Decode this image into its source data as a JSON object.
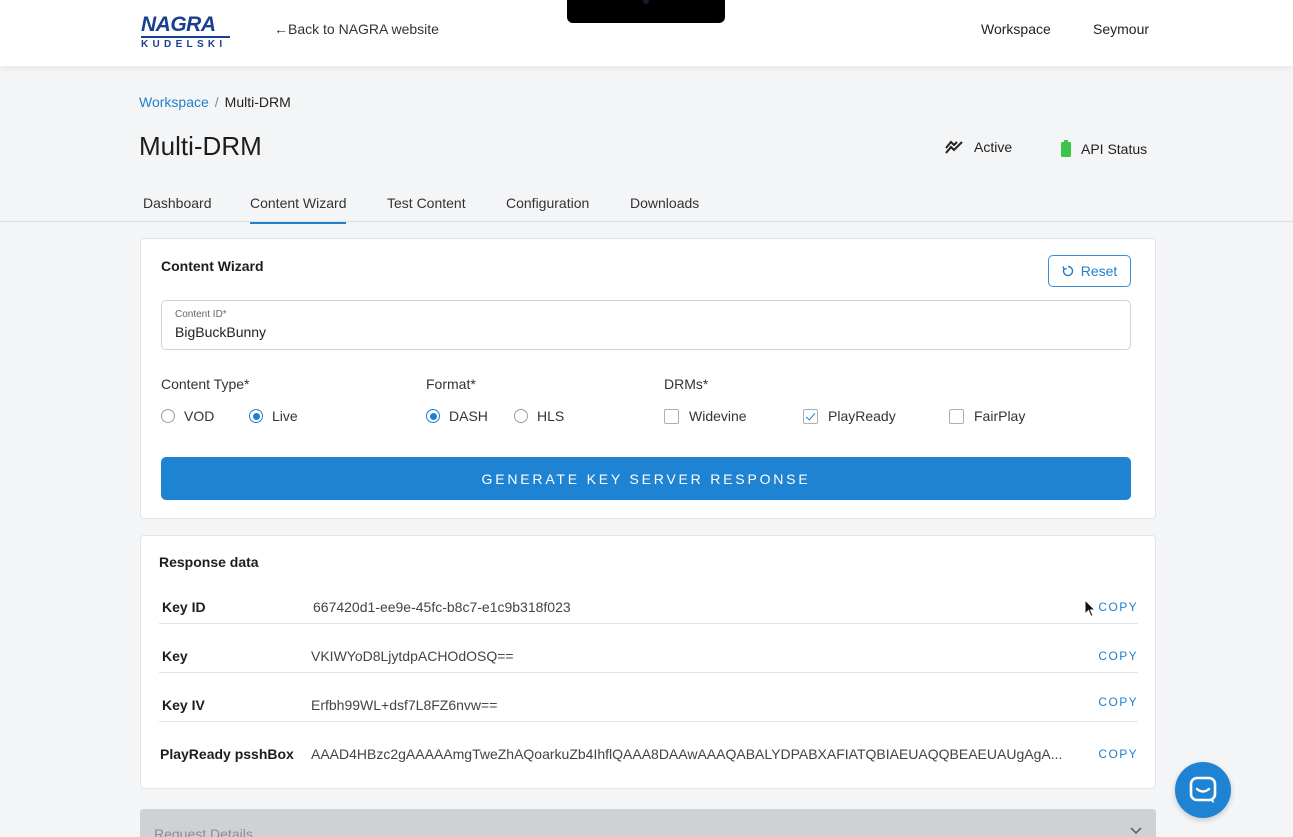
{
  "header": {
    "logo": {
      "line1": "NAGRA",
      "line2": "KUDELSKI"
    },
    "back_link": "←Back to NAGRA website",
    "nav": {
      "workspace": "Workspace",
      "user": "Seymour"
    }
  },
  "breadcrumb": {
    "parent": "Workspace",
    "separator": "/",
    "current": "Multi-DRM"
  },
  "page": {
    "title": "Multi-DRM",
    "status_active": "Active",
    "api_status": "API Status"
  },
  "tabs": [
    {
      "label": "Dashboard",
      "active": false
    },
    {
      "label": "Content Wizard",
      "active": true
    },
    {
      "label": "Test Content",
      "active": false
    },
    {
      "label": "Configuration",
      "active": false
    },
    {
      "label": "Downloads",
      "active": false
    }
  ],
  "wizard": {
    "title": "Content Wizard",
    "reset_label": "Reset",
    "content_id": {
      "label": "Content ID*",
      "value": "BigBuckBunny"
    },
    "content_type": {
      "label": "Content Type*",
      "options": [
        {
          "label": "VOD",
          "selected": false
        },
        {
          "label": "Live",
          "selected": true
        }
      ]
    },
    "format": {
      "label": "Format*",
      "options": [
        {
          "label": "DASH",
          "selected": true
        },
        {
          "label": "HLS",
          "selected": false
        }
      ]
    },
    "drms": {
      "label": "DRMs*",
      "options": [
        {
          "label": "Widevine",
          "checked": false
        },
        {
          "label": "PlayReady",
          "checked": true
        },
        {
          "label": "FairPlay",
          "checked": false
        }
      ]
    },
    "generate_label": "GENERATE KEY SERVER RESPONSE"
  },
  "response": {
    "title": "Response data",
    "copy_label": "COPY",
    "rows": [
      {
        "key": "Key ID",
        "value": "667420d1-ee9e-45fc-b8c7-e1c9b318f023"
      },
      {
        "key": "Key",
        "value": "VKIWYoD8LjytdpACHOdOSQ=="
      },
      {
        "key": "Key IV",
        "value": "Erfbh99WL+dsf7L8FZ6nvw=="
      },
      {
        "key": "PlayReady psshBox",
        "value": "AAAD4HBzc2gAAAAAmgTweZhAQoarkuZb4IhflQAAA8DAAwAAAQABALYDPABXAFIATQBIAEUAQQBEAEUAUgAgA..."
      }
    ]
  },
  "request_details": {
    "label": "Request Details"
  },
  "colors": {
    "accent": "#1f83d4",
    "link": "#1f7fce",
    "api_status": "#3ec44a"
  }
}
